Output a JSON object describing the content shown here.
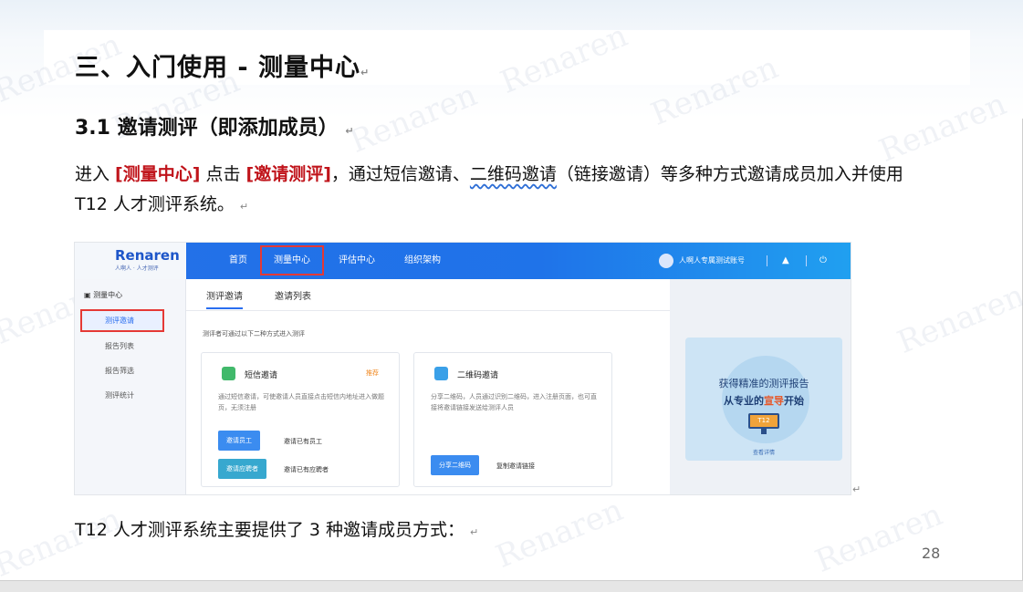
{
  "slide": {
    "heading": "三、入门使用 - 测量中心",
    "subheading": "3.1 邀请测评（即添加成员）",
    "paragraph": {
      "p1": "进入 ",
      "red1": "[测量中心]",
      "p2": " 点击 ",
      "red2": "[邀请测评]",
      "p3": "，通过短信邀请、",
      "underlined": "二维码邀请",
      "p4": "（链接邀请）等多种方式邀请成员加入并使用 T12 人才测评系统。"
    },
    "bottom_text": "T12 人才测评系统主要提供了 3 种邀请成员方式：",
    "page_number": "28",
    "return_mark": "↵",
    "watermark": "Renaren"
  },
  "app": {
    "logo": "Renaren",
    "logo_sub": "人啊人 · 人才测评",
    "nav": [
      "首页",
      "测量中心",
      "评估中心",
      "组织架构"
    ],
    "user_name": "人啊人专属测试账号",
    "sidebar": {
      "title": "测量中心",
      "items": [
        "测评邀请",
        "报告列表",
        "报告筛选",
        "测评统计"
      ]
    },
    "tabs": [
      "测评邀请",
      "邀请列表"
    ],
    "hint": "测评者可通过以下二种方式进入测评",
    "sms_card": {
      "title": "短信邀请",
      "tag": "推荐",
      "desc": "通过短信邀请，可使邀请人员直接点击短信内地址进入做题页，无须注册",
      "btn_invite_employee": "邀请员工",
      "link_invite_existing_employee": "邀请已有员工",
      "btn_invite_candidate": "邀请应聘者",
      "link_invite_existing_candidate": "邀请已有应聘者"
    },
    "qr_card": {
      "title": "二维码邀请",
      "desc": "分享二维码，人员通过识别二维码，进入注册页面，也可直接将邀请链接发送给测评人员",
      "btn_share_qr": "分享二维码",
      "link_copy": "复制邀请链接"
    },
    "promo": {
      "line1": "获得精准的测评报告",
      "line2_a": "从专业的",
      "line2_hl": "宣导",
      "line2_b": "开始",
      "monitor_text": "T12",
      "link": "查看详情"
    }
  }
}
